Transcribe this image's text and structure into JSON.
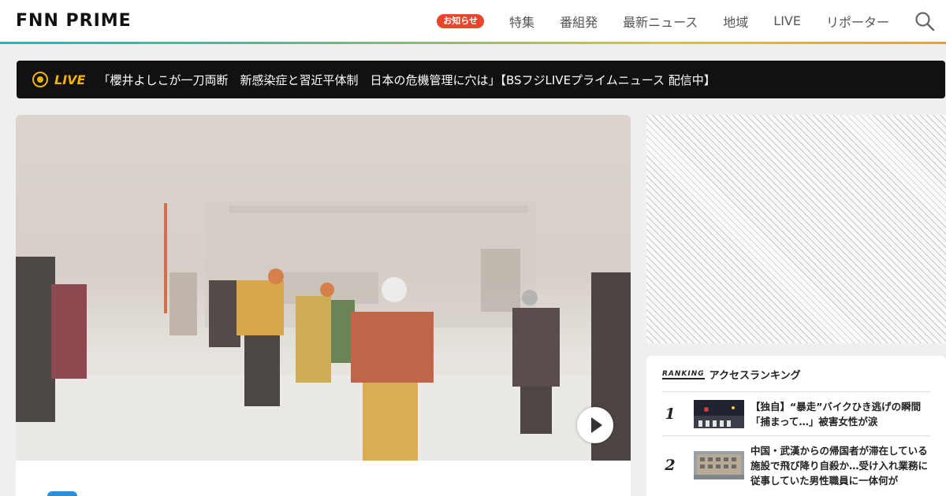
{
  "header": {
    "logo_text": "FNN PRIME",
    "notice_badge": "お知らせ",
    "nav": [
      "特集",
      "番組発",
      "最新ニュース",
      "地域",
      "LIVE",
      "リポーター"
    ],
    "search_icon": "search-icon"
  },
  "live_bar": {
    "label": "LIVE",
    "headline": "「櫻井よしこが一刀両断　新感染症と習近平体制　日本の危機管理に穴は」【BSフジLIVEプライムニュース 配信中】",
    "icon": "live-eye-icon"
  },
  "video": {
    "play_icon": "play-icon"
  },
  "ranking": {
    "label_en": "RANKING",
    "title": "アクセスランキング",
    "items": [
      {
        "rank": "1",
        "title": "【独自】“暴走”バイクひき逃げの瞬間　「捕まって…」被害女性が涙"
      },
      {
        "rank": "2",
        "title": "中国・武漢からの帰国者が滞在している施設で飛び降り自殺か…受け入れ業務に従事していた男性職員に一体何が"
      }
    ]
  },
  "colors": {
    "accent_red": "#e8452c",
    "live_yellow": "#f0b400",
    "brand_gradient": [
      "#2cb2c0",
      "#d9c14a",
      "#f29a3a"
    ]
  }
}
